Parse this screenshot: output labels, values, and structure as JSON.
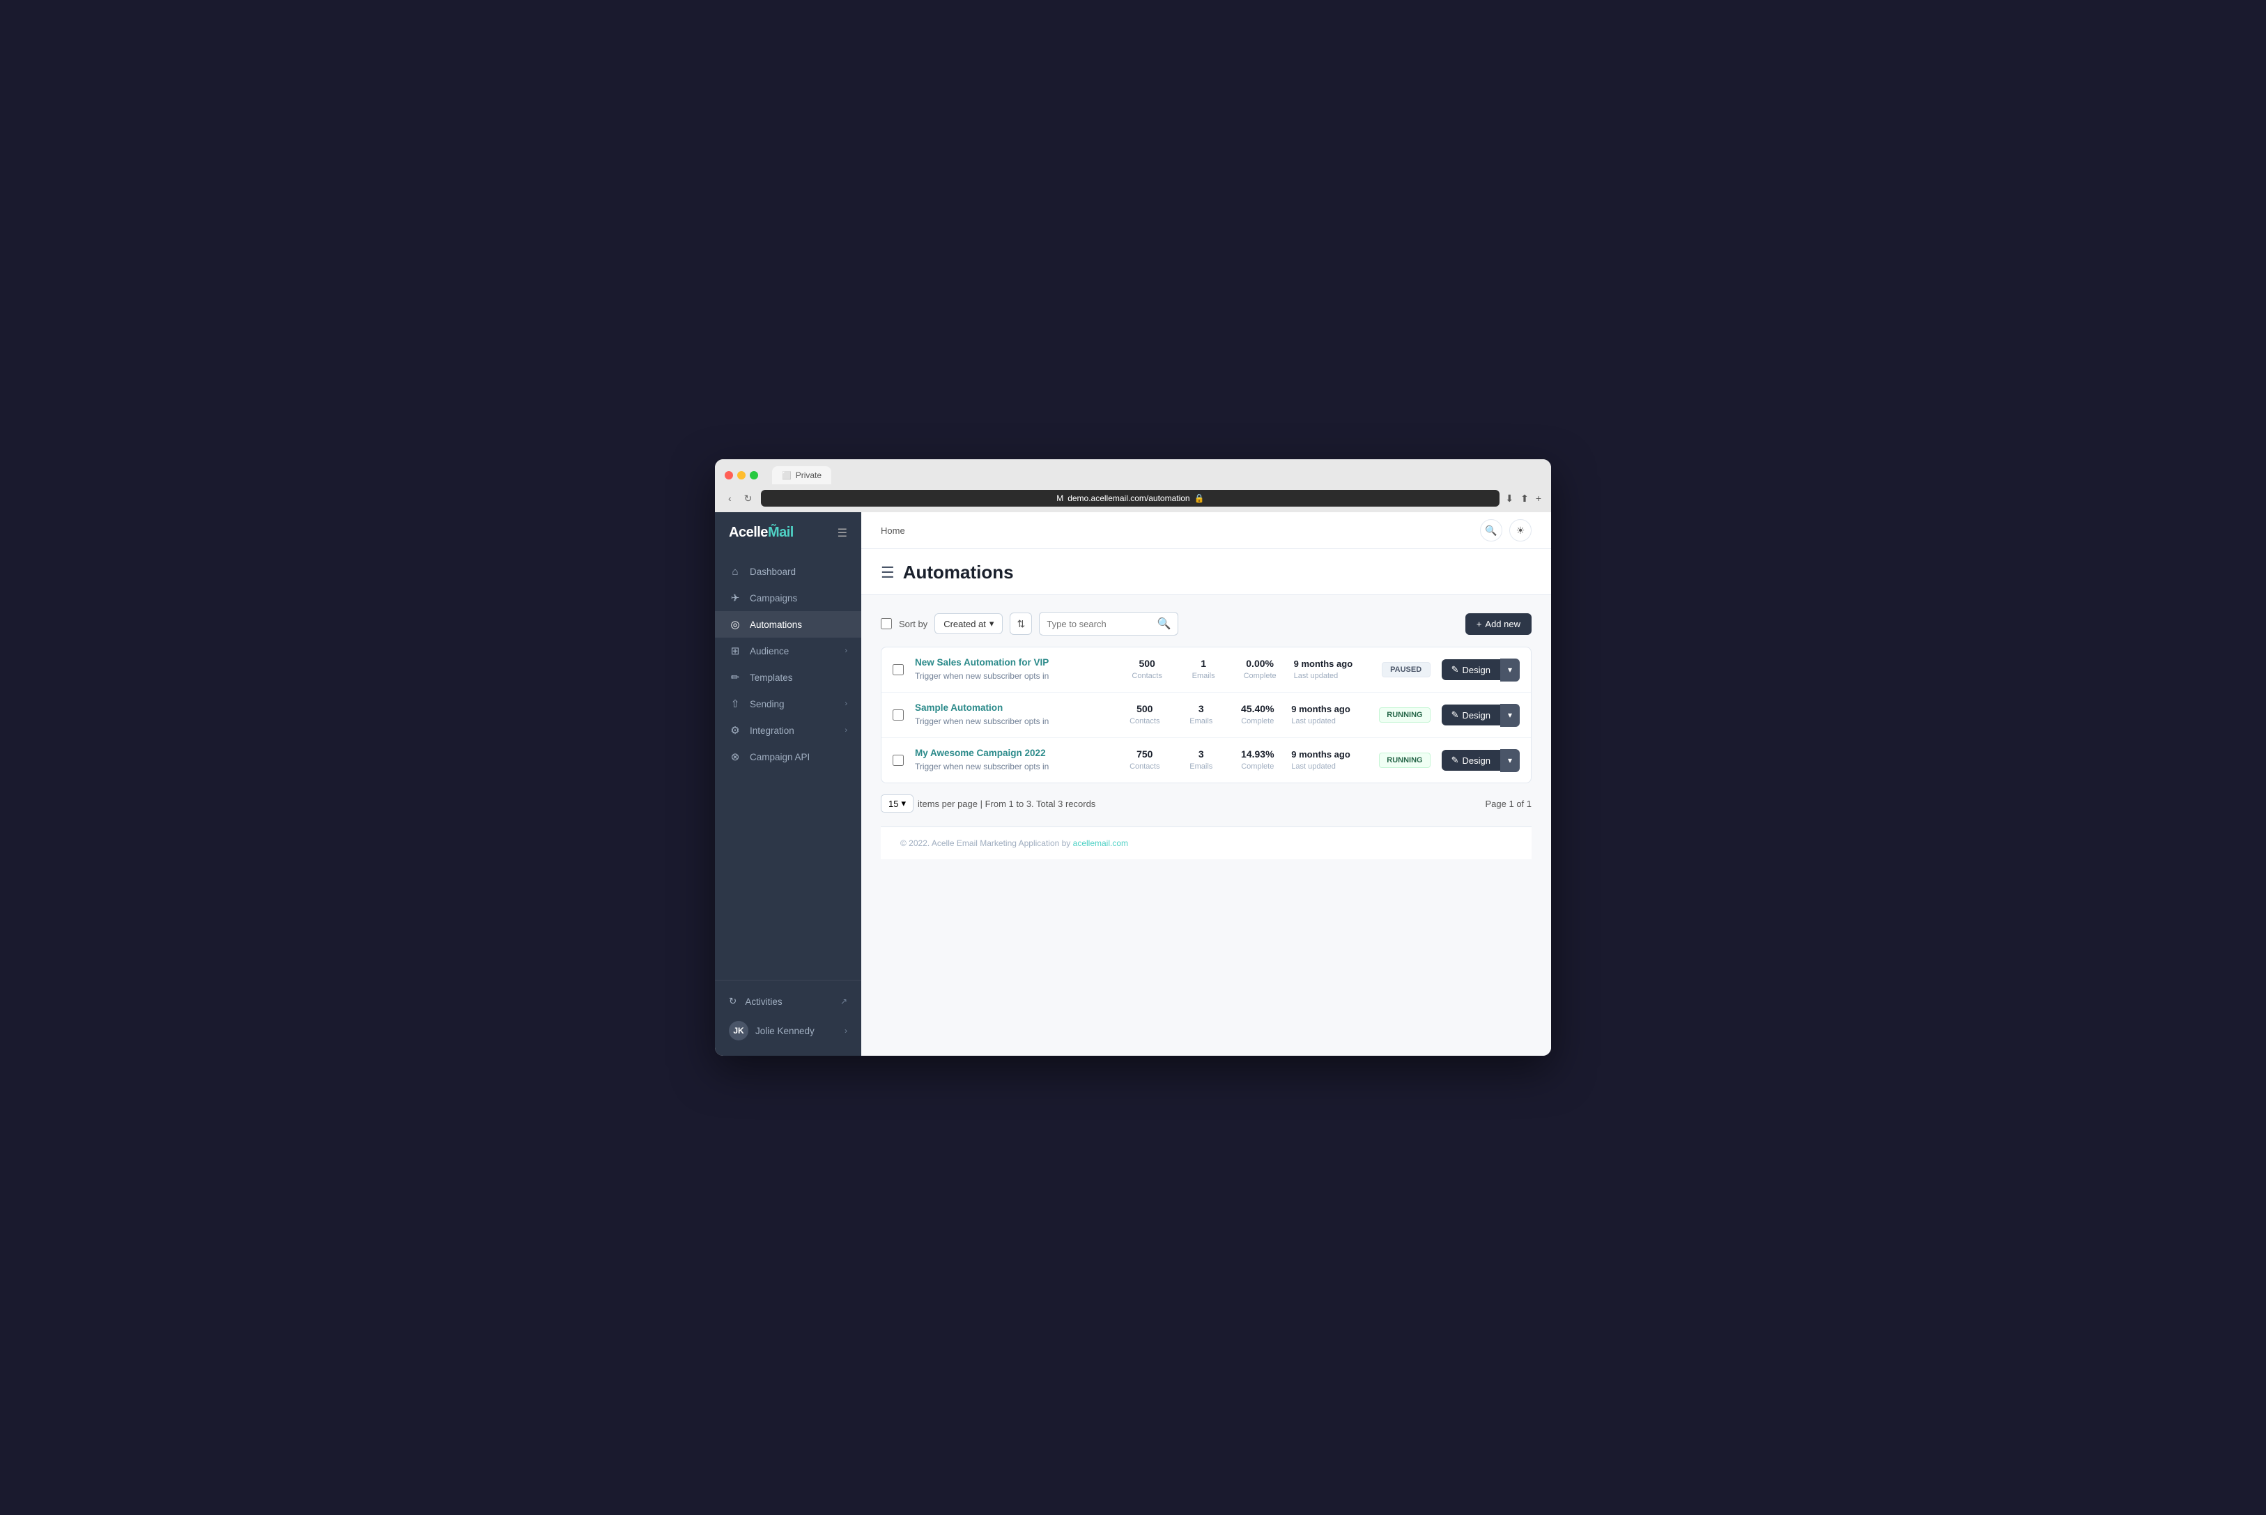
{
  "browser": {
    "tab_label": "Private",
    "url": "demo.acellemail.com/automation",
    "nav_back": "‹",
    "nav_refresh": "↻"
  },
  "header": {
    "breadcrumb": "Home",
    "search_icon": "🔍",
    "theme_icon": "☀"
  },
  "page": {
    "title": "Automations",
    "title_icon": "☰"
  },
  "toolbar": {
    "sort_label": "Sort by",
    "sort_value": "Created at",
    "search_placeholder": "Type to search",
    "add_button": "+ Add new"
  },
  "automations": [
    {
      "name": "New Sales Automation for VIP",
      "trigger": "Trigger when new subscriber opts in",
      "contacts": "500",
      "contacts_label": "Contacts",
      "emails": "1",
      "emails_label": "Emails",
      "complete": "0.00%",
      "complete_label": "Complete",
      "updated": "9 months ago",
      "updated_label": "Last updated",
      "status": "PAUSED",
      "status_class": "status-paused",
      "action": "Design"
    },
    {
      "name": "Sample Automation",
      "trigger": "Trigger when new subscriber opts in",
      "contacts": "500",
      "contacts_label": "Contacts",
      "emails": "3",
      "emails_label": "Emails",
      "complete": "45.40%",
      "complete_label": "Complete",
      "updated": "9 months ago",
      "updated_label": "Last updated",
      "status": "RUNNING",
      "status_class": "status-running",
      "action": "Design"
    },
    {
      "name": "My Awesome Campaign 2022",
      "trigger": "Trigger when new subscriber opts in",
      "contacts": "750",
      "contacts_label": "Contacts",
      "emails": "3",
      "emails_label": "Emails",
      "complete": "14.93%",
      "complete_label": "Complete",
      "updated": "9 months ago",
      "updated_label": "Last updated",
      "status": "RUNNING",
      "status_class": "status-running",
      "action": "Design"
    }
  ],
  "pagination": {
    "per_page": "15",
    "summary": "items per page  |  From 1 to 3. Total 3 records",
    "page_info": "Page 1 of 1"
  },
  "sidebar": {
    "logo": "Acelle",
    "logo_tilde": "M̃ail",
    "items": [
      {
        "label": "Dashboard",
        "icon": "⌂",
        "active": false
      },
      {
        "label": "Campaigns",
        "icon": "✈",
        "active": false
      },
      {
        "label": "Automations",
        "icon": "◎",
        "active": true
      },
      {
        "label": "Audience",
        "icon": "⊞",
        "active": false,
        "arrow": true
      },
      {
        "label": "Templates",
        "icon": "✏",
        "active": false
      },
      {
        "label": "Sending",
        "icon": "⇧",
        "active": false,
        "arrow": true
      },
      {
        "label": "Integration",
        "icon": "⚙",
        "active": false,
        "arrow": true
      },
      {
        "label": "Campaign API",
        "icon": "⊗",
        "active": false
      }
    ],
    "activities_label": "Activities",
    "user_name": "Jolie Kennedy"
  },
  "footer": {
    "text": "© 2022. Acelle Email Marketing Application by ",
    "link_text": "acellemail.com",
    "link_url": "#"
  }
}
